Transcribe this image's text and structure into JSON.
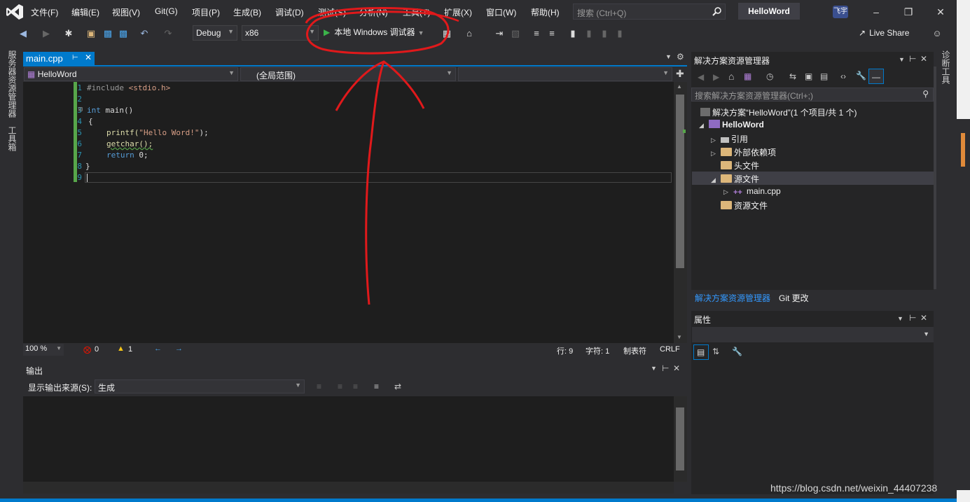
{
  "menu": {
    "items": [
      "文件(F)",
      "编辑(E)",
      "视图(V)",
      "Git(G)",
      "项目(P)",
      "生成(B)",
      "调试(D)",
      "测试(S)",
      "分析(N)",
      "工具(T)",
      "扩展(X)",
      "窗口(W)",
      "帮助(H)"
    ],
    "search_placeholder": "搜索 (Ctrl+Q)",
    "solution_title": "HelloWord",
    "avatar_text": "飞宇"
  },
  "toolbar": {
    "config": "Debug",
    "platform": "x86",
    "run_label": "本地 Windows 调试器",
    "live_share": "Live Share"
  },
  "left_strip": {
    "server_explorer": "服务器资源管理器",
    "toolbox": "工具箱"
  },
  "right_strip": {
    "diagnostics": "诊断工具"
  },
  "editor": {
    "tab_label": "main.cpp",
    "project_combo": "HelloWord",
    "scope_combo": "(全局范围)",
    "line_numbers": [
      "1",
      "2",
      "3",
      "4",
      "5",
      "6",
      "7",
      "8",
      "9"
    ],
    "code": {
      "l1_directive": "#include",
      "l1_header": "<stdio.h>",
      "l3_kw": "int",
      "l3_fn": "main()",
      "l4": "{",
      "l5_fn": "printf(",
      "l5_str": "\"Hello Word!\"",
      "l5_end": ");",
      "l6": "getchar();",
      "l7_kw": "return",
      "l7_rest": "0;",
      "l8": "}"
    }
  },
  "status": {
    "zoom": "100 %",
    "errors": "0",
    "warnings": "1",
    "line": "行: 9",
    "char": "字符: 1",
    "tabs": "制表符",
    "eol": "CRLF"
  },
  "output": {
    "title": "输出",
    "source_label": "显示输出来源(S):",
    "source_value": "生成"
  },
  "solution_explorer": {
    "title": "解决方案资源管理器",
    "search_placeholder": "搜索解决方案资源管理器(Ctrl+;)",
    "solution_node": "解决方案“HelloWord”(1 个项目/共 1 个)",
    "project_node": "HelloWord",
    "items": {
      "references": "引用",
      "external_deps": "外部依赖项",
      "headers": "头文件",
      "sources": "源文件",
      "main_cpp": "main.cpp",
      "resources": "资源文件"
    },
    "tab_solution": "解决方案资源管理器",
    "tab_git": "Git 更改"
  },
  "properties": {
    "title": "属性"
  },
  "watermark": "https://blog.csdn.net/weixin_44407238",
  "colors": {
    "accent": "#007acc",
    "background": "#2d2d30",
    "editor_bg": "#1e1e1e",
    "annotation": "#e0191b"
  }
}
